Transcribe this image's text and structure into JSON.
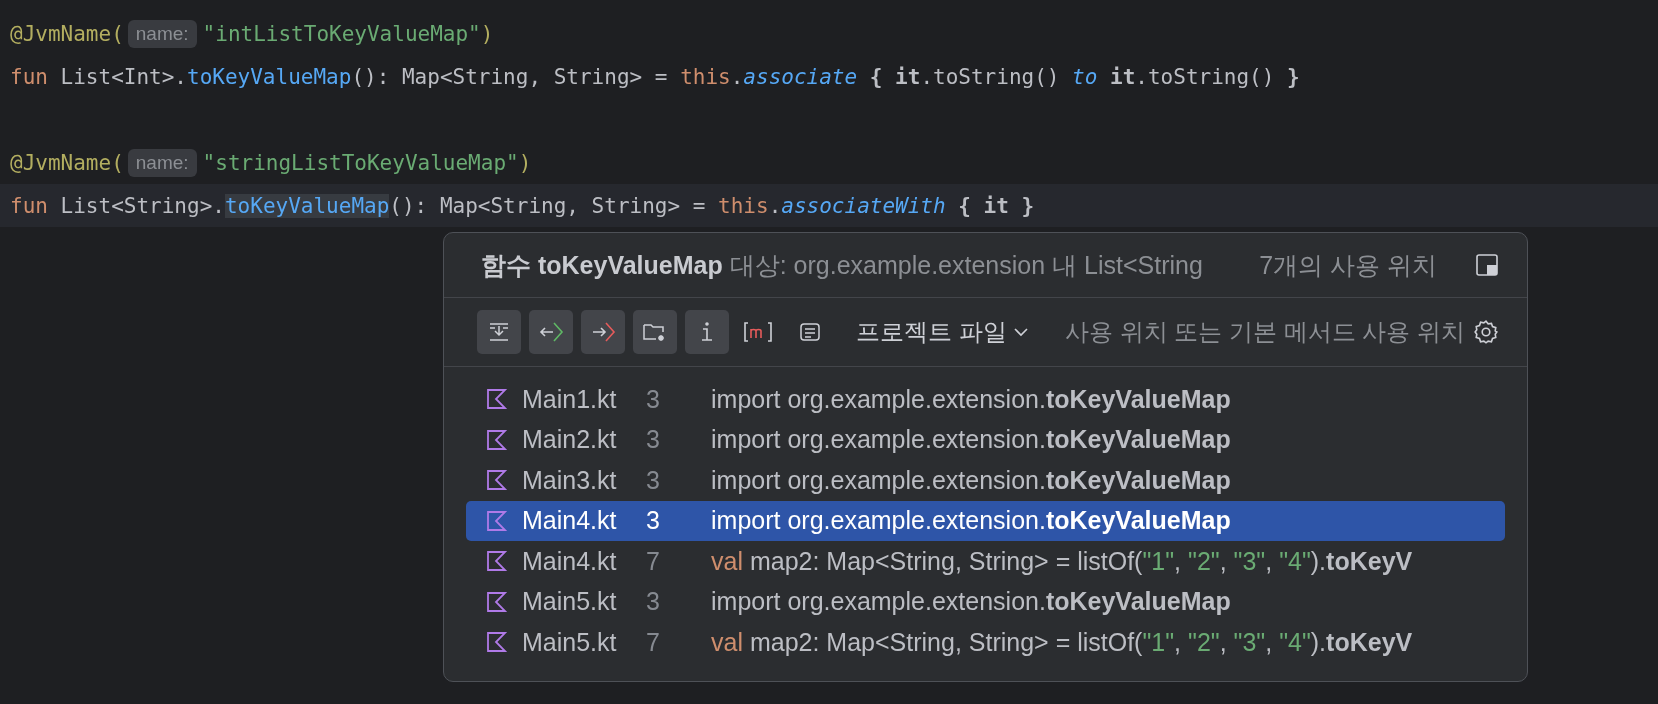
{
  "editor": {
    "lines": [
      {
        "kind": "code",
        "current": false,
        "segments": [
          {
            "kind": "code",
            "tokens": [
              {
                "text": "@JvmName(",
                "kind": "annotation"
              }
            ]
          },
          {
            "kind": "hint",
            "text": "name:"
          },
          {
            "kind": "code",
            "tokens": [
              {
                "text": "\"intListToKeyValueMap\"",
                "kind": "string"
              },
              {
                "text": ")",
                "kind": "annotation"
              }
            ]
          }
        ]
      },
      {
        "kind": "code",
        "current": false,
        "segments": [
          {
            "kind": "code",
            "tokens": [
              {
                "text": "fun",
                "kind": "keyword"
              },
              {
                "text": " List<Int>.",
                "kind": "plain"
              },
              {
                "text": "toKeyValueMap",
                "kind": "function"
              },
              {
                "text": "(): Map<String, String> = ",
                "kind": "plain"
              },
              {
                "text": "this",
                "kind": "keyword"
              },
              {
                "text": ".",
                "kind": "plain"
              },
              {
                "text": "associate",
                "kind": "call"
              },
              {
                "text": " { it",
                "kind": "bold"
              },
              {
                "text": ".toString() ",
                "kind": "plain"
              },
              {
                "text": "to",
                "kind": "call"
              },
              {
                "text": " it",
                "kind": "bold"
              },
              {
                "text": ".toString() ",
                "kind": "plain"
              },
              {
                "text": "}",
                "kind": "bold"
              }
            ]
          }
        ]
      },
      {
        "kind": "blank",
        "current": false
      },
      {
        "kind": "code",
        "current": false,
        "segments": [
          {
            "kind": "code",
            "tokens": [
              {
                "text": "@JvmName(",
                "kind": "annotation"
              }
            ]
          },
          {
            "kind": "hint",
            "text": "name:"
          },
          {
            "kind": "code",
            "tokens": [
              {
                "text": "\"stringListToKeyValueMap\"",
                "kind": "string"
              },
              {
                "text": ")",
                "kind": "annotation"
              }
            ]
          }
        ]
      },
      {
        "kind": "code",
        "current": true,
        "segments": [
          {
            "kind": "code",
            "tokens": [
              {
                "text": "fun",
                "kind": "keyword"
              },
              {
                "text": " List<String>.",
                "kind": "plain"
              },
              {
                "text": "toKeyValueMap",
                "kind": "usage"
              },
              {
                "text": "(): Map<String, String> = ",
                "kind": "plain"
              },
              {
                "text": "this",
                "kind": "keyword"
              },
              {
                "text": ".",
                "kind": "plain"
              },
              {
                "text": "associateWith",
                "kind": "call"
              },
              {
                "text": " { it }",
                "kind": "bold"
              }
            ]
          }
        ]
      }
    ]
  },
  "popup": {
    "title": "**함수 toKeyValueMap** 대상: org.example.extension 내 List<String",
    "count": "7개의 사용 위치",
    "toolbar": [
      {
        "kind": "merge",
        "on": true
      },
      {
        "kind": "read",
        "on": true
      },
      {
        "kind": "write",
        "on": true
      },
      {
        "kind": "folder",
        "on": true
      },
      {
        "kind": "info",
        "on": true
      },
      {
        "kind": "method",
        "on": false
      },
      {
        "kind": "list",
        "on": false
      }
    ],
    "scope": "프로젝트 파일",
    "filter": "사용 위치 또는 기본 메서드 사용 위치",
    "rows": [
      {
        "file": "Main1.kt",
        "line": "3",
        "selected": false,
        "tokens": [
          {
            "text": "import org.example.extension.",
            "kind": "plain"
          },
          {
            "text": "toKeyValueMap",
            "kind": "bold"
          }
        ]
      },
      {
        "file": "Main2.kt",
        "line": "3",
        "selected": false,
        "tokens": [
          {
            "text": "import org.example.extension.",
            "kind": "plain"
          },
          {
            "text": "toKeyValueMap",
            "kind": "bold"
          }
        ]
      },
      {
        "file": "Main3.kt",
        "line": "3",
        "selected": false,
        "tokens": [
          {
            "text": "import org.example.extension.",
            "kind": "plain"
          },
          {
            "text": "toKeyValueMap",
            "kind": "bold"
          }
        ]
      },
      {
        "file": "Main4.kt",
        "line": "3",
        "selected": true,
        "tokens": [
          {
            "text": "import org.example.extension.",
            "kind": "plain"
          },
          {
            "text": "toKeyValueMap",
            "kind": "bold"
          }
        ]
      },
      {
        "file": "Main4.kt",
        "line": "7",
        "selected": false,
        "tokens": [
          {
            "text": "val",
            "kind": "keyword"
          },
          {
            "text": " map2: Map<String, String> = listOf(",
            "kind": "plain"
          },
          {
            "text": "\"1\"",
            "kind": "string"
          },
          {
            "text": ", ",
            "kind": "plain"
          },
          {
            "text": "\"2\"",
            "kind": "string"
          },
          {
            "text": ", ",
            "kind": "plain"
          },
          {
            "text": "\"3\"",
            "kind": "string"
          },
          {
            "text": ", ",
            "kind": "plain"
          },
          {
            "text": "\"4\"",
            "kind": "string"
          },
          {
            "text": ").",
            "kind": "plain"
          },
          {
            "text": "toKeyV",
            "kind": "bold"
          }
        ]
      },
      {
        "file": "Main5.kt",
        "line": "3",
        "selected": false,
        "tokens": [
          {
            "text": "import org.example.extension.",
            "kind": "plain"
          },
          {
            "text": "toKeyValueMap",
            "kind": "bold"
          }
        ]
      },
      {
        "file": "Main5.kt",
        "line": "7",
        "selected": false,
        "tokens": [
          {
            "text": "val",
            "kind": "keyword"
          },
          {
            "text": " map2: Map<String, String> = listOf(",
            "kind": "plain"
          },
          {
            "text": "\"1\"",
            "kind": "string"
          },
          {
            "text": ", ",
            "kind": "plain"
          },
          {
            "text": "\"2\"",
            "kind": "string"
          },
          {
            "text": ", ",
            "kind": "plain"
          },
          {
            "text": "\"3\"",
            "kind": "string"
          },
          {
            "text": ", ",
            "kind": "plain"
          },
          {
            "text": "\"4\"",
            "kind": "string"
          },
          {
            "text": ").",
            "kind": "plain"
          },
          {
            "text": "toKeyV",
            "kind": "bold"
          }
        ]
      }
    ]
  }
}
